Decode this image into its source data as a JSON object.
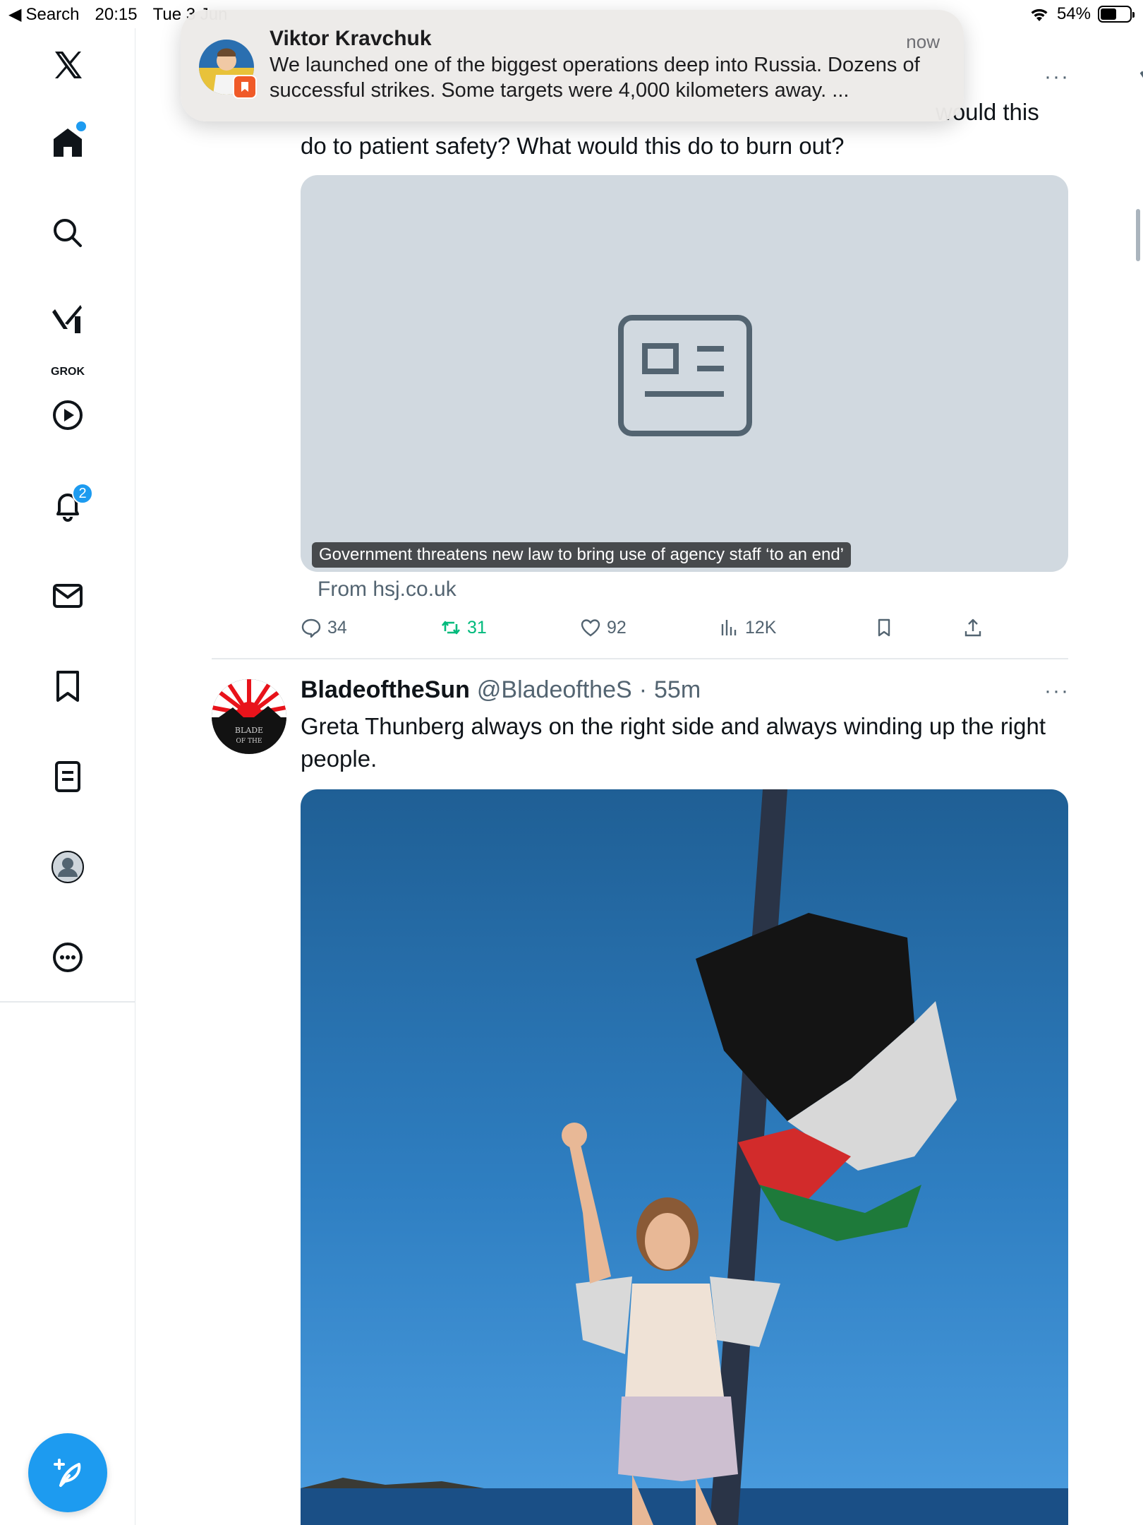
{
  "status_bar": {
    "back_label": "Search",
    "time": "20:15",
    "date": "Tue 3 Jun",
    "battery": "54%",
    "battery_level": 0.54
  },
  "sidebar": {
    "grok_label": "GROK",
    "notifications_badge": "2",
    "items": [
      "x-logo",
      "home",
      "search",
      "grok",
      "video",
      "notifications",
      "messages",
      "bookmarks",
      "lists",
      "profile",
      "more"
    ]
  },
  "notification": {
    "sender": "Viktor Kravchuk",
    "time": "now",
    "body": "We launched one of the biggest operations deep into Russia. Dozens of successful strikes. Some targets were 4,000 kilometers away. ..."
  },
  "tweet1": {
    "text_partial_line": "would this",
    "text_line2": "do to patient safety? What would this do to burn out?",
    "card_caption": "Government threatens new law to bring use of agency staff ‘to an end’",
    "card_source": "From hsj.co.uk",
    "replies": "34",
    "reposts": "31",
    "likes": "92",
    "views": "12K"
  },
  "tweet2": {
    "name": "BladeoftheSun",
    "handle": "@BladeoftheS",
    "separator": "·",
    "time": "55m",
    "text": "Greta Thunberg always on the right side and always winding up the right people."
  },
  "colors": {
    "accent": "#1d9bf0",
    "repost_green": "#00ba7c",
    "muted": "#536471"
  }
}
